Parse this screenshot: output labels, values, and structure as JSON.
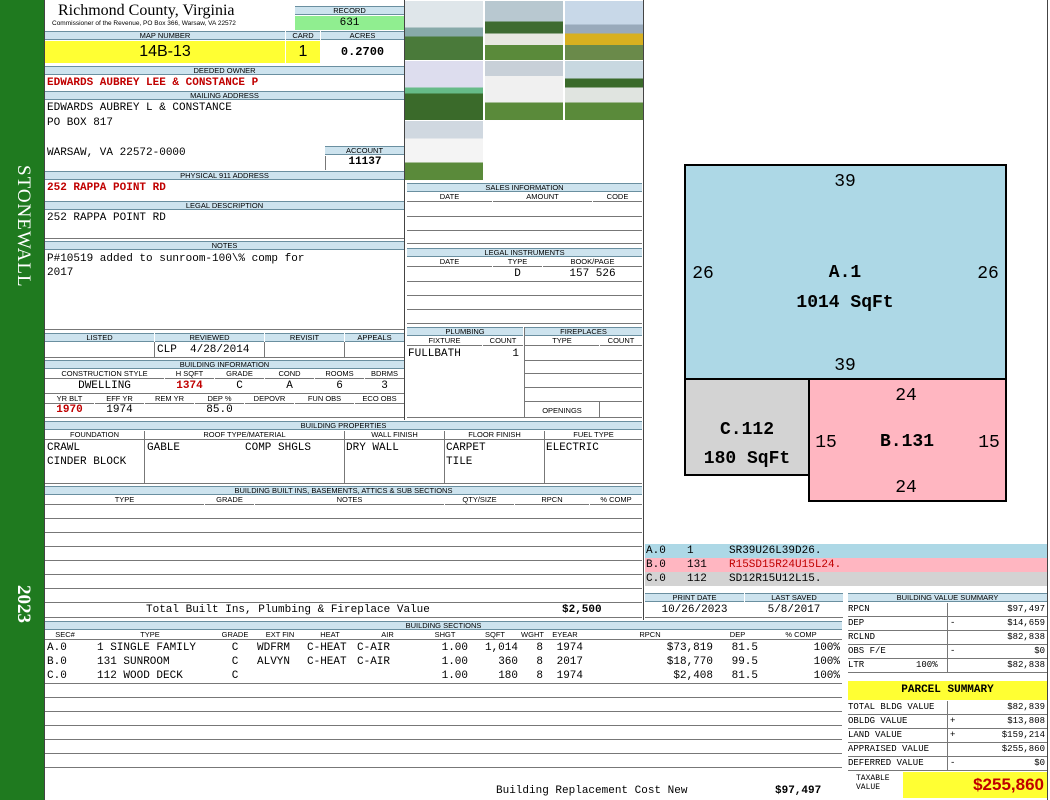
{
  "sidebar": {
    "district": "STONEWALL",
    "year": "2023"
  },
  "header": {
    "county": "Richmond County, Virginia",
    "commissioner": "Commissioner of the Revenue, PO Box 366, Warsaw, VA 22572",
    "record_label": "RECORD",
    "record": "631",
    "map_label": "MAP NUMBER",
    "map": "14B-13",
    "card_label": "CARD",
    "card": "1",
    "acres_label": "ACRES",
    "acres": "0.2700"
  },
  "owner": {
    "label": "DEEDED OWNER",
    "value": "EDWARDS AUBREY LEE & CONSTANCE P"
  },
  "mailing": {
    "label": "MAILING ADDRESS",
    "line1": "EDWARDS AUBREY L & CONSTANCE",
    "line2": "PO BOX 817",
    "line3": "WARSAW, VA 22572-0000"
  },
  "account": {
    "label": "ACCOUNT",
    "value": "11137"
  },
  "physical": {
    "label": "PHYSICAL 911 ADDRESS",
    "value": "252 RAPPA POINT RD"
  },
  "legal": {
    "label": "LEGAL DESCRIPTION",
    "value": "252 RAPPA POINT RD"
  },
  "notes": {
    "label": "NOTES",
    "line1": "P#10519 added to sunroom-100\\% comp for",
    "line2": "2017"
  },
  "review": {
    "h_listed": "LISTED",
    "h_reviewed": "REVIEWED",
    "h_revisit": "REVISIT",
    "h_appeals": "APPEALS",
    "reviewed": "CLP  4/28/2014"
  },
  "bldg_info": {
    "label": "BUILDING INFORMATION",
    "h_style": "CONSTRUCTION STYLE",
    "h_hsqft": "H SQFT",
    "h_grade": "GRADE",
    "h_cond": "COND",
    "h_rooms": "ROOMS",
    "h_bdrms": "BDRMS",
    "style": "DWELLING",
    "hsqft": "1374",
    "grade": "C",
    "cond": "A",
    "rooms": "6",
    "bdrms": "3",
    "h_yrblt": "YR BLT",
    "h_effyr": "EFF YR",
    "h_remyr": "REM YR",
    "h_dep": "DEP %",
    "h_depovr": "DEPOVR",
    "h_funobs": "FUN OBS",
    "h_ecoobs": "ECO OBS",
    "yrblt": "1970",
    "effyr": "1974",
    "dep": "85.0"
  },
  "sales": {
    "label": "SALES INFORMATION",
    "h_date": "DATE",
    "h_amount": "AMOUNT",
    "h_code": "CODE"
  },
  "instruments": {
    "label": "LEGAL INSTRUMENTS",
    "h_date": "DATE",
    "h_type": "TYPE",
    "h_book": "BOOK/PAGE",
    "type": "D",
    "book": "157 526"
  },
  "plumbing": {
    "label": "PLUMBING",
    "h_fixture": "FIXTURE",
    "h_count": "COUNT",
    "fixture": "FULLBATH",
    "count": "1"
  },
  "fireplaces": {
    "label": "FIREPLACES",
    "h_type": "TYPE",
    "h_count": "COUNT",
    "openings": "OPENINGS"
  },
  "props": {
    "label": "BUILDING PROPERTIES",
    "h_found": "FOUNDATION",
    "h_roof": "ROOF TYPE/MATERIAL",
    "h_wall": "WALL FINISH",
    "h_floor": "FLOOR FINISH",
    "h_fuel": "FUEL TYPE",
    "found1": "CRAWL",
    "found2": "CINDER BLOCK",
    "roof1": "GABLE",
    "roof2": "COMP SHGLS",
    "wall": "DRY WALL",
    "floor1": "CARPET",
    "floor2": "TILE",
    "fuel": "ELECTRIC"
  },
  "builtins": {
    "label": "BUILDING BUILT INS, BASEMENTS, ATTICS & SUB SECTIONS",
    "h_type": "TYPE",
    "h_grade": "GRADE",
    "h_notes": "NOTES",
    "h_qty": "QTY/SIZE",
    "h_rpcn": "RPCN",
    "h_comp": "% COMP",
    "total_label": "Total Built Ins, Plumbing & Fireplace Value",
    "total": "$2,500"
  },
  "print": {
    "h_print": "PRINT DATE",
    "h_saved": "LAST SAVED",
    "print": "10/26/2023",
    "saved": "5/8/2017"
  },
  "sections": {
    "label": "BUILDING SECTIONS",
    "headers": [
      "SEC#",
      "TYPE",
      "GRADE",
      "EXT FIN",
      "HEAT",
      "AIR",
      "SHGT",
      "SQFT",
      "WGHT",
      "EYEAR",
      "RPCN",
      "DEP",
      "% COMP"
    ],
    "rows": [
      [
        "A.0",
        "1 SINGLE FAMILY",
        "C",
        "WDFRM",
        "C-HEAT",
        "C-AIR",
        "1.00",
        "1,014",
        "8",
        "1974",
        "$73,819",
        "81.5",
        "100%"
      ],
      [
        "B.0",
        "131 SUNROOM",
        "C",
        "ALVYN",
        "C-HEAT",
        "C-AIR",
        "1.00",
        "360",
        "8",
        "2017",
        "$18,770",
        "99.5",
        "100%"
      ],
      [
        "C.0",
        "112 WOOD DECK",
        "C",
        "",
        "",
        "",
        "1.00",
        "180",
        "8",
        "1974",
        "$2,408",
        "81.5",
        "100%"
      ]
    ],
    "brcn_label": "Building Replacement Cost New",
    "brcn": "$97,497"
  },
  "sketch": {
    "a_label": "A.1",
    "a_area": "1014 SqFt",
    "a_top": "39",
    "a_bottom": "39",
    "a_left": "26",
    "a_right": "26",
    "b_label": "B.131",
    "b_top": "24",
    "b_bottom": "24",
    "b_left": "15",
    "b_right": "15",
    "c_label": "C.112",
    "c_area": "180 SqFt",
    "legend": [
      {
        "sec": "A.0",
        "code": "1",
        "vector": "SR39U26L39D26.",
        "color": "#add8e6"
      },
      {
        "sec": "B.0",
        "code": "131",
        "vector": "R15SD15R24U15L24.",
        "color": "#ffb6c1"
      },
      {
        "sec": "C.0",
        "code": "112",
        "vector": "SD12R15U12L15.",
        "color": "#d3d3d3"
      }
    ]
  },
  "bvs": {
    "label": "BUILDING VALUE SUMMARY",
    "rpcn_l": "RPCN",
    "rpcn": "$97,497",
    "dep_l": "DEP",
    "dep_sign": "-",
    "dep": "$14,659",
    "rclnd_l": "RCLND",
    "rclnd": "$82,838",
    "obs_l": "OBS F/E",
    "obs_sign": "-",
    "obs": "$0",
    "ltr_l": "LTR",
    "ltr_pct": "100%",
    "ltr": "$82,838"
  },
  "parcel": {
    "label": "PARCEL SUMMARY",
    "tbv_l": "TOTAL BLDG VALUE",
    "tbv": "$82,839",
    "obldg_l": "OBLDG VALUE",
    "obldg_sign": "+",
    "obldg": "$13,808",
    "land_l": "LAND VALUE",
    "land_sign": "+",
    "land": "$159,214",
    "appr_l": "APPRAISED VALUE",
    "appr": "$255,860",
    "def_l": "DEFERRED VALUE",
    "def_sign": "-",
    "def": "$0",
    "tax_l1": "TAXABLE",
    "tax_l2": "VALUE",
    "tax": "$255,860"
  },
  "colors": {
    "sidebar": "#1f7a1f",
    "yellow": "#ffff33",
    "green": "#90ee90",
    "header_blue": "#cde3ee",
    "red": "#c00000"
  }
}
